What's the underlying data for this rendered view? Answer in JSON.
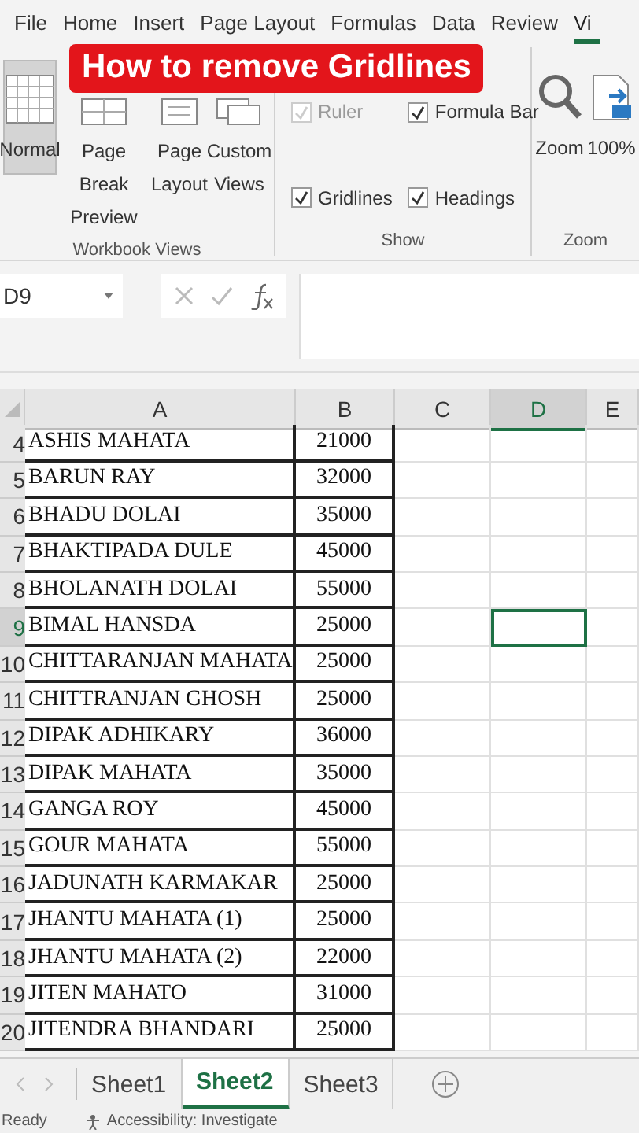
{
  "menu_tabs": [
    {
      "label": "File",
      "selected": false
    },
    {
      "label": "Home",
      "selected": false
    },
    {
      "label": "Insert",
      "selected": false
    },
    {
      "label": "Page Layout",
      "selected": false
    },
    {
      "label": "Formulas",
      "selected": false
    },
    {
      "label": "Data",
      "selected": false
    },
    {
      "label": "Review",
      "selected": false
    },
    {
      "label": "Vi",
      "selected": true
    }
  ],
  "banner": "How to remove Gridlines",
  "ribbon": {
    "workbook_views": {
      "label": "Workbook Views",
      "buttons": [
        {
          "kind": "normal",
          "label": "Normal",
          "selected": true
        },
        {
          "kind": "pagebreak",
          "label": "Page Break Preview",
          "selected": false
        },
        {
          "kind": "pagelayout",
          "label": "Page Layout",
          "selected": false
        },
        {
          "kind": "custom",
          "label": "Custom Views",
          "selected": false
        }
      ]
    },
    "show": {
      "label": "Show",
      "items": [
        {
          "label": "Ruler",
          "checked": true,
          "disabled": true
        },
        {
          "label": "Formula Bar",
          "checked": true,
          "disabled": false
        },
        {
          "label": "Gridlines",
          "checked": true,
          "disabled": false
        },
        {
          "label": "Headings",
          "checked": true,
          "disabled": false
        }
      ]
    },
    "zoom": {
      "label": "Zoom",
      "buttons": [
        {
          "kind": "zoom",
          "label": "Zoom"
        },
        {
          "kind": "hundred",
          "label": "100%"
        }
      ]
    }
  },
  "formula_bar": {
    "name_box": "D9"
  },
  "columns": [
    {
      "label": "A",
      "selected": false
    },
    {
      "label": "B",
      "selected": false
    },
    {
      "label": "C",
      "selected": false
    },
    {
      "label": "D",
      "selected": true
    },
    {
      "label": "E",
      "selected": false
    }
  ],
  "rows": [
    {
      "num": "4",
      "name": "ASHIS MAHATA",
      "amount": "21000",
      "selected": false
    },
    {
      "num": "5",
      "name": "BARUN RAY",
      "amount": "32000",
      "selected": false
    },
    {
      "num": "6",
      "name": "BHADU DOLAI",
      "amount": "35000",
      "selected": false
    },
    {
      "num": "7",
      "name": "BHAKTIPADA DULE",
      "amount": "45000",
      "selected": false
    },
    {
      "num": "8",
      "name": "BHOLANATH DOLAI",
      "amount": "55000",
      "selected": false
    },
    {
      "num": "9",
      "name": "BIMAL HANSDA",
      "amount": "25000",
      "selected": true
    },
    {
      "num": "10",
      "name": "CHITTARANJAN MAHATA",
      "amount": "25000",
      "selected": false
    },
    {
      "num": "11",
      "name": "CHITTRANJAN GHOSH",
      "amount": "25000",
      "selected": false
    },
    {
      "num": "12",
      "name": "DIPAK ADHIKARY",
      "amount": "36000",
      "selected": false
    },
    {
      "num": "13",
      "name": "DIPAK MAHATA",
      "amount": "35000",
      "selected": false
    },
    {
      "num": "14",
      "name": "GANGA ROY",
      "amount": "45000",
      "selected": false
    },
    {
      "num": "15",
      "name": "GOUR MAHATA",
      "amount": "55000",
      "selected": false
    },
    {
      "num": "16",
      "name": "JADUNATH KARMAKAR",
      "amount": "25000",
      "selected": false
    },
    {
      "num": "17",
      "name": "JHANTU MAHATA (1)",
      "amount": "25000",
      "selected": false
    },
    {
      "num": "18",
      "name": "JHANTU MAHATA (2)",
      "amount": "22000",
      "selected": false
    },
    {
      "num": "19",
      "name": "JITEN MAHATO",
      "amount": "31000",
      "selected": false
    },
    {
      "num": "20",
      "name": "JITENDRA BHANDARI",
      "amount": "25000",
      "selected": false
    }
  ],
  "sheet_tabs": [
    {
      "label": "Sheet1",
      "selected": false
    },
    {
      "label": "Sheet2",
      "selected": true
    },
    {
      "label": "Sheet3",
      "selected": false
    }
  ],
  "status_bar": {
    "mode": "Ready",
    "accessibility": "Accessibility: Investigate"
  }
}
